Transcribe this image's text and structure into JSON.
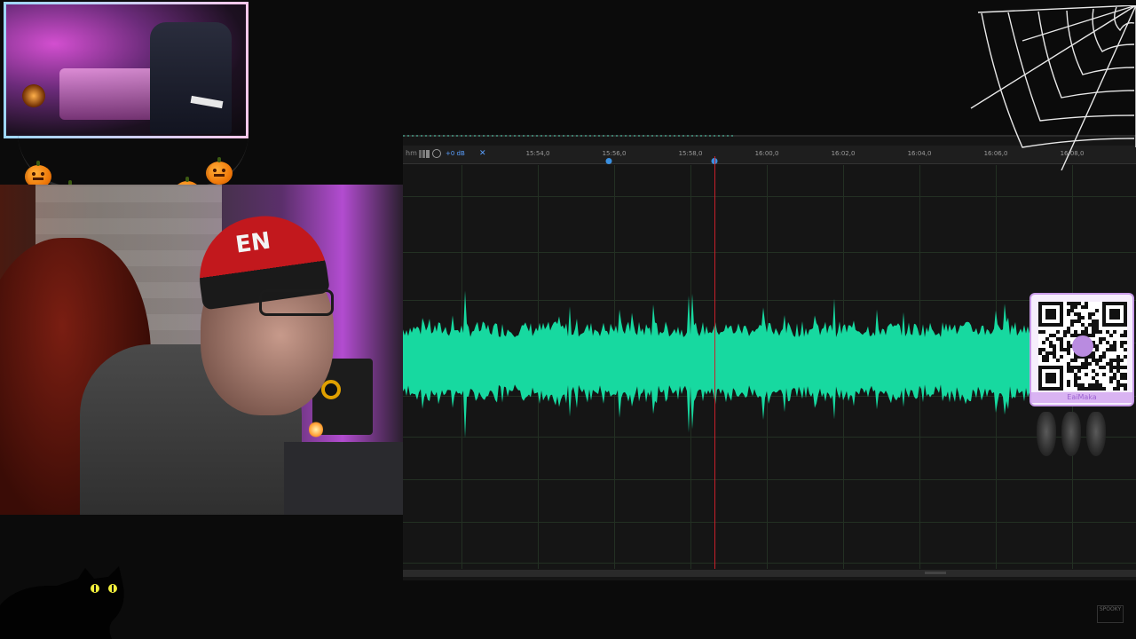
{
  "editor": {
    "ruler": {
      "hm_label": "hm",
      "db_label": "+0 dB",
      "ticks": [
        "15:54,0",
        "15:56,0",
        "15:58,0",
        "16:00,0",
        "16:02,0",
        "16:04,0",
        "16:06,0",
        "16:08,0"
      ]
    },
    "waveform_color": "#17d9a0",
    "playhead_color": "#c8202a"
  },
  "qr": {
    "label": "EaiMaka"
  },
  "overlay": {
    "beanie_text": "EN",
    "corner_logo": "SPOOKY"
  },
  "icons": [
    "pumpkin-icon",
    "spider-web-icon",
    "bat-icon",
    "black-cat-icon",
    "clock-icon",
    "pin-icon"
  ]
}
